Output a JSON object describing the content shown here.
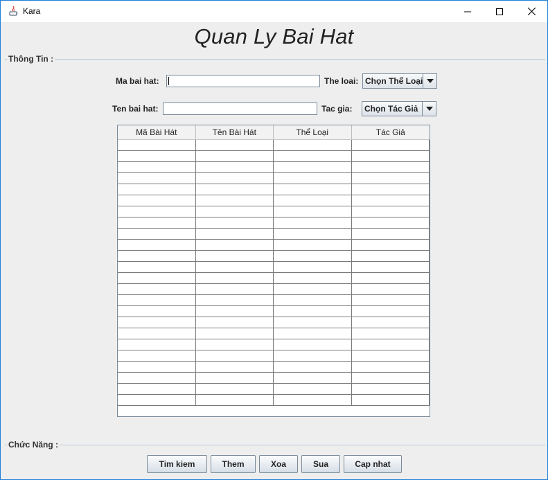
{
  "window": {
    "title": "Kara",
    "controls": [
      "minimize-icon",
      "maximize-icon",
      "close-icon"
    ]
  },
  "heading": "Quan Ly Bai Hat",
  "info_group": {
    "label": "Thông Tin :"
  },
  "form": {
    "ma_label": "Ma bai hat:",
    "ma_value": "",
    "ten_label": "Ten bai hat:",
    "ten_value": "",
    "theloai_label": "The loai:",
    "theloai_selected": "Chọn Thể Loại",
    "tacgia_label": "Tac gia:",
    "tacgia_selected": "Chọn Tác Giả"
  },
  "table": {
    "columns": [
      "Mã Bài Hát",
      "Tên Bài Hát",
      "Thể Loại",
      "Tác Giả"
    ],
    "rows": []
  },
  "function_group": {
    "label": "Chức Năng :"
  },
  "buttons": {
    "search": "Tim kiem",
    "add": "Them",
    "delete": "Xoa",
    "edit": "Sua",
    "update": "Cap nhat"
  },
  "colors": {
    "window_border": "#1c7fd6",
    "panel_bg": "#eeeeee",
    "group_line": "#b8c6d6"
  }
}
